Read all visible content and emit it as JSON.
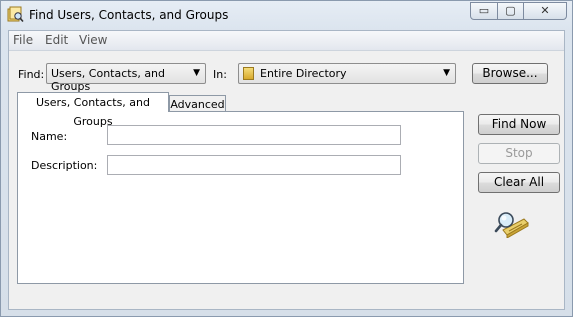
{
  "window": {
    "title": "Find Users, Contacts, and Groups",
    "controls": {
      "minimize": "▭",
      "maximize": "▢",
      "close": "✕"
    }
  },
  "menu": {
    "items": [
      "File",
      "Edit",
      "View"
    ]
  },
  "find": {
    "label": "Find:",
    "value": "Users, Contacts, and Groups"
  },
  "in": {
    "label": "In:",
    "value": "Entire Directory"
  },
  "browse_button": "Browse...",
  "tabs": [
    {
      "label": "Users, Contacts, and Groups",
      "active": true
    },
    {
      "label": "Advanced",
      "active": false
    }
  ],
  "form": {
    "name_label": "Name:",
    "name_value": "",
    "description_label": "Description:",
    "description_value": ""
  },
  "buttons": {
    "find_now": "Find Now",
    "stop": "Stop",
    "clear_all": "Clear All"
  },
  "icons": {
    "app": "find-users-icon",
    "search": "magnifier-directory-icon"
  }
}
